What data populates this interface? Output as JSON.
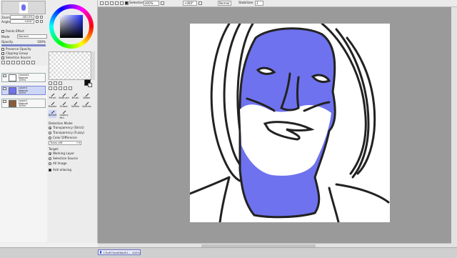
{
  "toolbar": {
    "selection_label": "Selection",
    "zoom_value": "400%",
    "angle_value": "+000°",
    "blend_mode": "Normal",
    "stabilizer_label": "Stabilizer",
    "stabilizer_value": "3"
  },
  "navigator": {
    "zoom_label": "Zoom",
    "zoom_value": "400.0%",
    "angle_label": "Angle",
    "angle_value": "+000°"
  },
  "layer_props": {
    "paints_effect": "Paints Effect",
    "mode_label": "Mode",
    "mode_value": "Normal",
    "opacity_label": "Opacity",
    "opacity_value": "100%",
    "preserve_opacity": "Preserve Opacity",
    "clipping_group": "Clipping Group",
    "selection_source": "Selection Source"
  },
  "layers": [
    {
      "name": "Lineart1",
      "mode": "Normal",
      "opacity": "100%",
      "selected": false,
      "thumb_color": "#ffffff"
    },
    {
      "name": "Layer2",
      "mode": "Normal",
      "opacity": "100%",
      "selected": true,
      "thumb_color": "#6e72ee"
    },
    {
      "name": "Layer1",
      "mode": "Normal",
      "opacity": "100%",
      "selected": false,
      "thumb_color": "#8a5a3a"
    }
  ],
  "tools": [
    {
      "name": "Pencil",
      "icon": "pencil-icon"
    },
    {
      "name": "AirBrush",
      "icon": "airbrush-icon"
    },
    {
      "name": "Brush",
      "icon": "brush-icon"
    },
    {
      "name": "Water",
      "icon": "water-icon"
    },
    {
      "name": "Marker",
      "icon": "marker-icon"
    },
    {
      "name": "Eraser",
      "icon": "eraser-icon"
    },
    {
      "name": "SelPen",
      "icon": "selpen-icon"
    },
    {
      "name": "SelEras",
      "icon": "seleras-icon"
    },
    {
      "name": "Bucket",
      "icon": "bucket-icon"
    },
    {
      "name": "Legacy Pen",
      "icon": "legacy-pen-icon"
    }
  ],
  "bucket": {
    "detection_mode_label": "Detection Mode:",
    "modes": [
      "Transparency (Strict)",
      "Transparency (Fuzzy)",
      "Color Difference"
    ],
    "selected_mode": 0,
    "trans_diff_value": "Trans diff",
    "trans_diff_num": "+0",
    "target_label": "Target:",
    "targets": [
      "Working Layer",
      "Selection Source",
      "All Image"
    ],
    "selected_target": 0,
    "antialiasing": "Anti-aliasing"
  },
  "colors": {
    "primary": "#111111",
    "secondary": "#ffffff",
    "fill_blue": "#6e72ee",
    "canvas_bg": "#9a9a9a"
  },
  "document_tab": {
    "filename": "17b4f74ed56dd51...",
    "zoom": "400%"
  }
}
